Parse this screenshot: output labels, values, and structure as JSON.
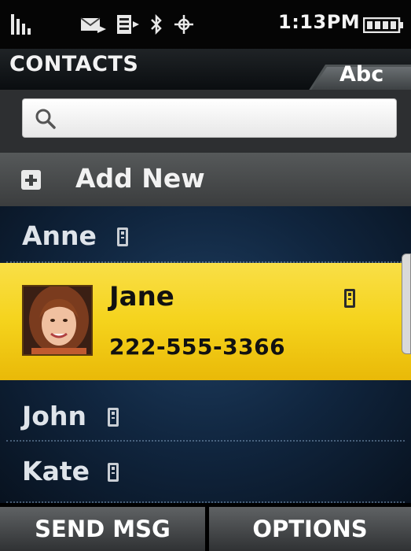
{
  "status_bar": {
    "time": "1:13PM",
    "icons": [
      "signal-icon",
      "message-icon",
      "sim-card-icon",
      "bluetooth-icon",
      "gps-icon",
      "battery-icon"
    ]
  },
  "header": {
    "title": "CONTACTS",
    "sort_tab": "Abc"
  },
  "search": {
    "placeholder": "",
    "value": ""
  },
  "add_new": {
    "label": "Add New"
  },
  "contacts": [
    {
      "name": "Anne",
      "icon": "mobile-phone-icon"
    },
    {
      "name": "Jane",
      "number": "222-555-3366",
      "icon": "mobile-phone-icon",
      "selected": true
    },
    {
      "name": "John",
      "icon": "mobile-phone-icon"
    },
    {
      "name": "Kate",
      "icon": "mobile-phone-icon"
    }
  ],
  "softkeys": {
    "left": "SEND MSG",
    "right": "OPTIONS"
  },
  "colors": {
    "selection": "#f5d31c",
    "list_background": "#10253e",
    "header_background": "#0a0d10"
  }
}
